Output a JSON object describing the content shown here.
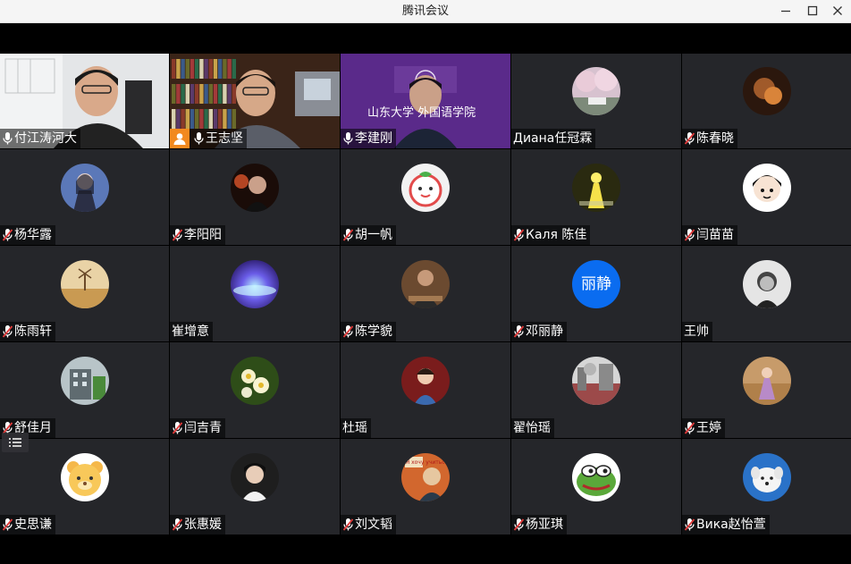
{
  "window": {
    "title": "腾讯会议"
  },
  "participants": [
    {
      "name": "付江涛河大",
      "mic": "on",
      "type": "video-office",
      "active": true
    },
    {
      "name": "王志坚",
      "mic": "on",
      "type": "video-bookshelf",
      "host": true
    },
    {
      "name": "李建刚",
      "mic": "on",
      "type": "video-banner",
      "banner_text": "山东大学 外国语学院"
    },
    {
      "name": "Диана任冠霖",
      "mic": "none",
      "type": "avatar",
      "avatar_color": "#c9b3c4",
      "avatar_icon": "cherry-blossom-photo-icon"
    },
    {
      "name": "陈春晓",
      "mic": "muted",
      "type": "avatar",
      "avatar_color": "#4a2a18",
      "avatar_icon": "dark-portrait-photo-icon"
    },
    {
      "name": "杨华露",
      "mic": "muted",
      "type": "avatar",
      "avatar_color": "#3d4f8a",
      "avatar_icon": "anime-girl-icon"
    },
    {
      "name": "李阳阳",
      "mic": "muted",
      "type": "avatar",
      "avatar_color": "#3a1a12",
      "avatar_icon": "night-portrait-icon"
    },
    {
      "name": "胡一帆",
      "mic": "muted",
      "type": "avatar",
      "avatar_color": "#f1f1f1",
      "avatar_icon": "cartoon-tomato-icon"
    },
    {
      "name": "Каля  陈佳",
      "mic": "muted",
      "type": "avatar",
      "avatar_color": "#2d2d12",
      "avatar_icon": "glowing-figure-icon"
    },
    {
      "name": "闫苗苗",
      "mic": "muted",
      "type": "avatar",
      "avatar_color": "#ffffff",
      "avatar_icon": "cartoon-boy-icon"
    },
    {
      "name": "陈雨轩",
      "mic": "muted",
      "type": "avatar",
      "avatar_color": "#d8b27a",
      "avatar_icon": "windmill-field-icon"
    },
    {
      "name": "崔增意",
      "mic": "none",
      "type": "avatar",
      "avatar_color": "#5a3fc0",
      "avatar_icon": "aurora-planet-icon"
    },
    {
      "name": "陈学貌",
      "mic": "muted",
      "type": "avatar",
      "avatar_color": "#5b3b22",
      "avatar_icon": "man-portrait-icon"
    },
    {
      "name": "邓丽静",
      "mic": "muted",
      "type": "text-avatar",
      "avatar_color": "#0a6cf0",
      "avatar_text": "丽静"
    },
    {
      "name": "王帅",
      "mic": "none",
      "type": "avatar",
      "avatar_color": "#d9d9d9",
      "avatar_icon": "bw-portrait-icon"
    },
    {
      "name": "舒佳月",
      "mic": "muted",
      "type": "avatar",
      "avatar_color": "#7c8a8e",
      "avatar_icon": "building-photo-icon"
    },
    {
      "name": "闫吉青",
      "mic": "muted",
      "type": "avatar",
      "avatar_color": "#2f4d17",
      "avatar_icon": "white-flowers-icon"
    },
    {
      "name": "杜瑶",
      "mic": "none",
      "type": "avatar",
      "avatar_color": "#7a1e1e",
      "avatar_icon": "child-portrait-icon"
    },
    {
      "name": "翟怡瑶",
      "mic": "none",
      "type": "avatar",
      "avatar_color": "#a8a8a8",
      "avatar_icon": "street-photo-icon"
    },
    {
      "name": "王婷",
      "mic": "muted",
      "type": "avatar",
      "avatar_color": "#b48ab8",
      "avatar_icon": "field-girl-icon"
    },
    {
      "name": "史思谦",
      "mic": "muted",
      "type": "avatar",
      "avatar_color": "#fbe4b0",
      "avatar_icon": "cartoon-bear-icon"
    },
    {
      "name": "张惠媛",
      "mic": "muted",
      "type": "avatar",
      "avatar_color": "#2a2a2a",
      "avatar_icon": "boy-portrait-icon"
    },
    {
      "name": "刘文韬",
      "mic": "muted",
      "type": "avatar",
      "avatar_color": "#c85a2a",
      "avatar_icon": "poster-meme-icon",
      "avatar_caption": "Я хочу учиться!"
    },
    {
      "name": "杨亚琪",
      "mic": "muted",
      "type": "avatar",
      "avatar_color": "#ffffff",
      "avatar_icon": "pepe-frog-icon"
    },
    {
      "name": "Вика赵怡萱",
      "mic": "muted",
      "type": "avatar",
      "avatar_color": "#2a72c8",
      "avatar_icon": "white-dog-icon"
    }
  ]
}
